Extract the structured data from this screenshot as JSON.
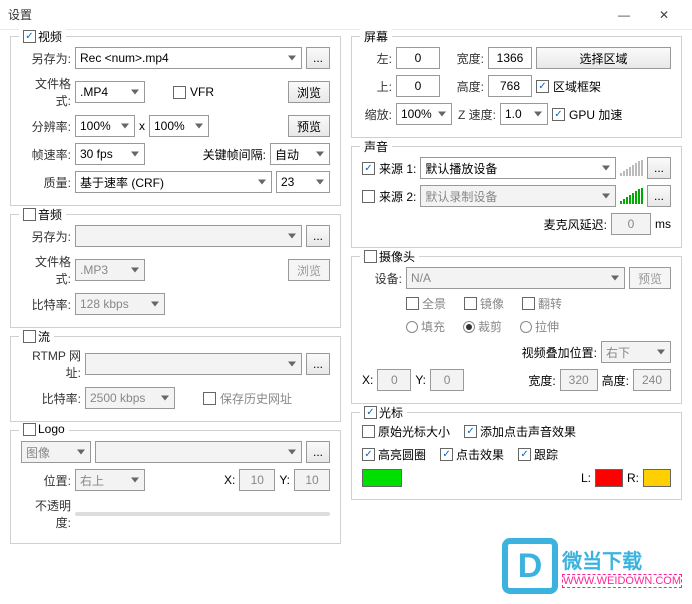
{
  "window": {
    "title": "设置",
    "minimize": "—",
    "close": "✕"
  },
  "video": {
    "header": "视频",
    "saveAsLabel": "另存为:",
    "saveAsValue": "Rec <num>.mp4",
    "browseBtn": "...",
    "formatLabel": "文件格式:",
    "formatValue": ".MP4",
    "vfrLabel": "VFR",
    "browseTxt": "浏览",
    "resLabel": "分辨率:",
    "resW": "100%",
    "x": "x",
    "resH": "100%",
    "previewBtn": "预览",
    "fpsLabel": "帧速率:",
    "fpsValue": "30 fps",
    "kfLabel": "关键帧间隔:",
    "kfValue": "自动",
    "qLabel": "质量:",
    "qMode": "基于速率 (CRF)",
    "qVal": "23"
  },
  "audio": {
    "header": "音频",
    "saveAsLabel": "另存为:",
    "formatLabel": "文件格式:",
    "formatValue": ".MP3",
    "browseTxt": "浏览",
    "bitrateLabel": "比特率:",
    "bitrateValue": "128 kbps"
  },
  "stream": {
    "header": "流",
    "rtmpLabel": "RTMP 网址:",
    "bitrateLabel": "比特率:",
    "bitrateValue": "2500 kbps",
    "keepLabel": "保存历史网址"
  },
  "logo": {
    "header": "Logo",
    "imageLabel": "图像",
    "posLabel": "位置:",
    "posValue": "右上",
    "xLabel": "X:",
    "xValue": "10",
    "yLabel": "Y:",
    "yValue": "10",
    "opacityLabel": "不透明度:"
  },
  "screen": {
    "header": "屏幕",
    "leftLabel": "左:",
    "leftVal": "0",
    "widthLabel": "宽度:",
    "widthVal": "1366",
    "selectBtn": "选择区域",
    "topLabel": "上:",
    "topVal": "0",
    "heightLabel": "高度:",
    "heightVal": "768",
    "frameLabel": "区域框架",
    "zoomLabel": "缩放:",
    "zoomVal": "100%",
    "zspeedLabel": "Z 速度:",
    "zspeedVal": "1.0",
    "gpuLabel": "GPU 加速"
  },
  "sound": {
    "header": "声音",
    "src1Label": "来源 1:",
    "src1Val": "默认播放设备",
    "src2Label": "来源 2:",
    "src2Val": "默认录制设备",
    "micDelayLabel": "麦克风延迟:",
    "micDelayVal": "0",
    "ms": "ms"
  },
  "camera": {
    "header": "摄像头",
    "devLabel": "设备:",
    "devVal": "N/A",
    "previewBtn": "预览",
    "panorama": "全景",
    "mirror": "镜像",
    "flip": "翻转",
    "fill": "填充",
    "crop": "裁剪",
    "stretch": "拉伸",
    "overlayLabel": "视频叠加位置:",
    "overlayVal": "右下",
    "xLabel": "X:",
    "xVal": "0",
    "yLabel": "Y:",
    "yVal": "0",
    "wLabel": "宽度:",
    "wVal": "320",
    "hLabel": "高度:",
    "hVal": "240"
  },
  "cursor": {
    "header": "光标",
    "orig": "原始光标大小",
    "addClick": "添加点击声音效果",
    "highlight": "高亮圆圈",
    "clickFx": "点击效果",
    "track": "跟踪",
    "L": "L:",
    "R": "R:"
  },
  "watermark": {
    "brand": "微当下载",
    "url": "WWW.WEIDOWN.COM"
  }
}
